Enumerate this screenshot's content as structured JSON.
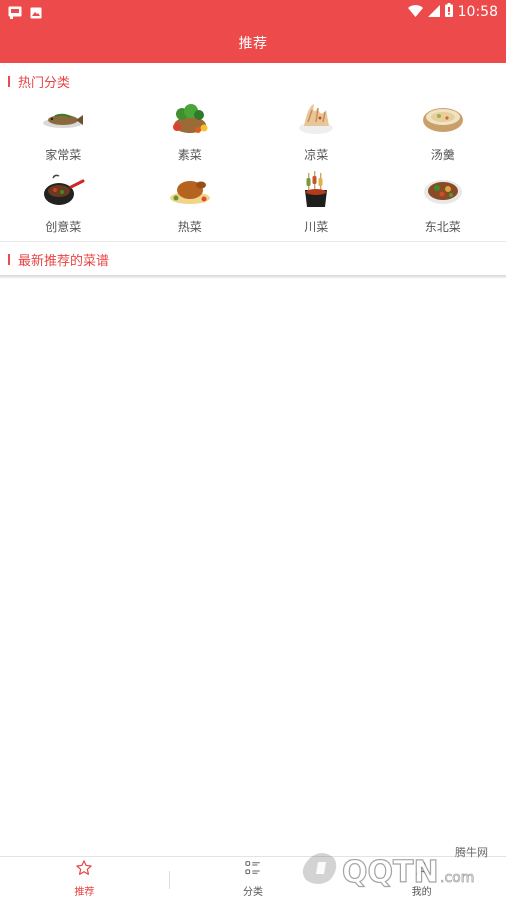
{
  "status_bar": {
    "time": "10:58",
    "left_icons": [
      "notification-app-icon",
      "image-notification-icon"
    ],
    "right_icons": [
      "wifi-icon",
      "signal-icon",
      "battery-icon"
    ]
  },
  "header": {
    "title": "推荐"
  },
  "hot_categories": {
    "title": "热门分类",
    "items": [
      {
        "label": "家常菜",
        "icon": "fish-dish-icon"
      },
      {
        "label": "素菜",
        "icon": "vegetable-basket-icon"
      },
      {
        "label": "凉菜",
        "icon": "cold-noodles-icon"
      },
      {
        "label": "汤羹",
        "icon": "soup-bowl-icon"
      },
      {
        "label": "创意菜",
        "icon": "wok-dish-icon"
      },
      {
        "label": "热菜",
        "icon": "roast-chicken-icon"
      },
      {
        "label": "川菜",
        "icon": "skewers-pot-icon"
      },
      {
        "label": "东北菜",
        "icon": "stew-plate-icon"
      }
    ]
  },
  "latest_recipes": {
    "title": "最新推荐的菜谱"
  },
  "bottom_nav": {
    "items": [
      {
        "label": "推荐",
        "icon": "star-icon",
        "active": true
      },
      {
        "label": "分类",
        "icon": "list-icon",
        "active": false
      },
      {
        "label": "我的",
        "icon": "person-icon",
        "active": false
      }
    ]
  },
  "watermark": {
    "top_text": "腾牛网",
    "logo_text": "QQTN.com"
  },
  "colors": {
    "brand_red": "#ec4a4b",
    "accent_text": "#e84444"
  }
}
